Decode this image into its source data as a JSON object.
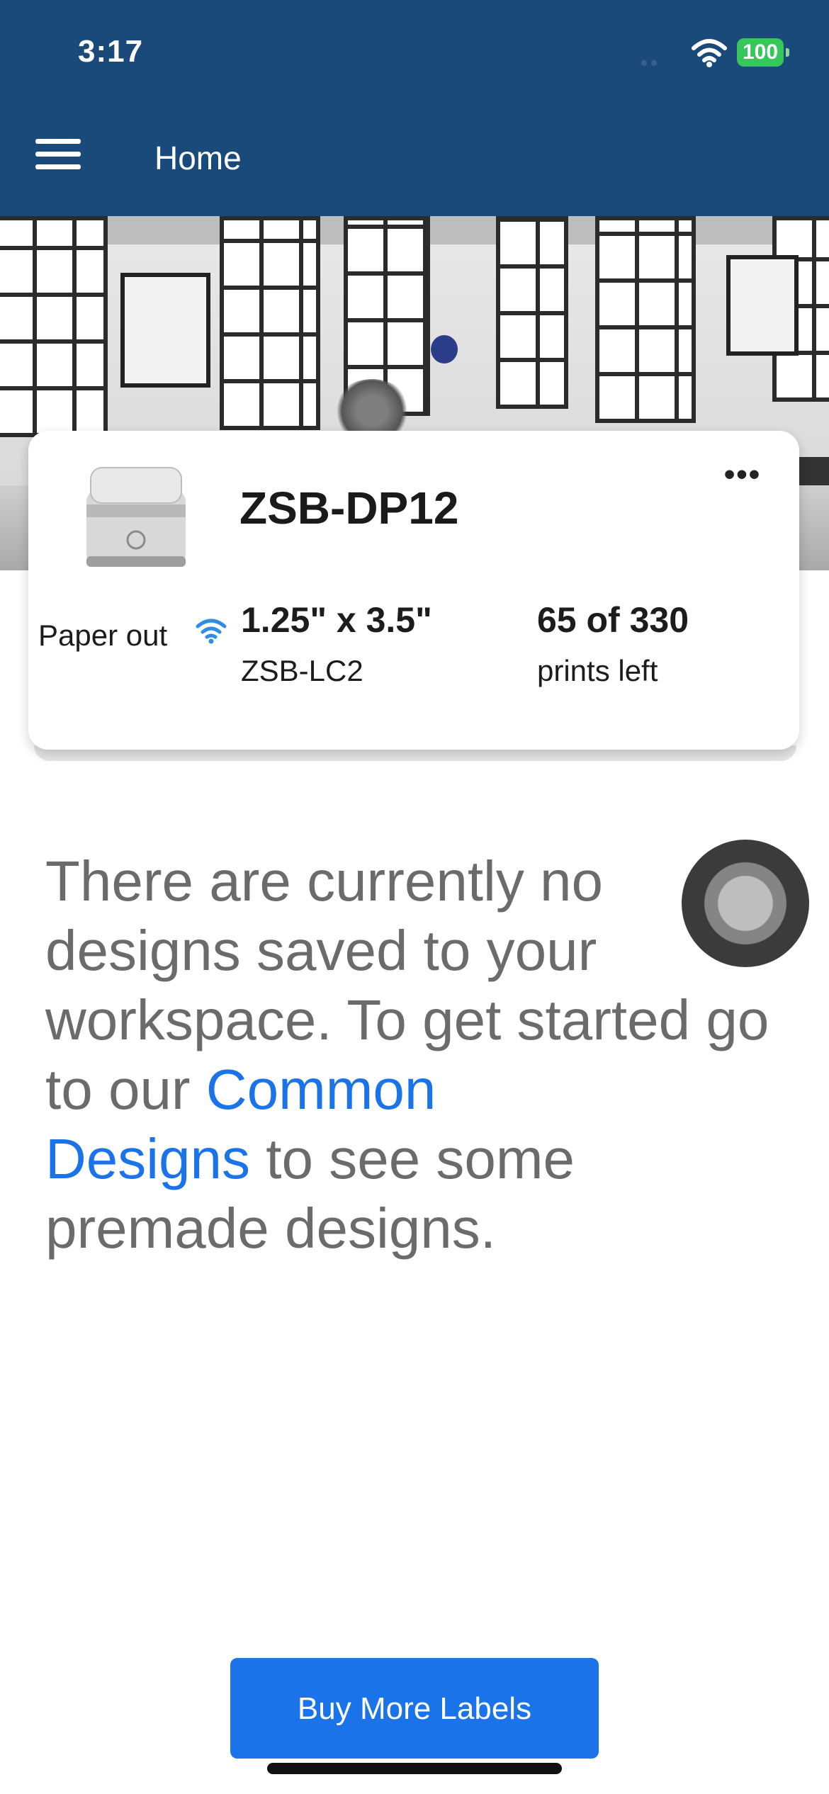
{
  "status_bar": {
    "time": "3:17",
    "battery": "100"
  },
  "header": {
    "title": "Home"
  },
  "printer": {
    "name": "ZSB-DP12",
    "status": "Paper out",
    "label_size": "1.25\" x 3.5\"",
    "label_model": "ZSB-LC2",
    "prints_count": "65 of 330",
    "prints_sub": "prints left",
    "more_label": "•••"
  },
  "message": {
    "before": "There are currently no designs saved to your workspace. To get started go to our ",
    "link_common": "Common",
    "link_designs": "Designs",
    "after": " to see some premade designs."
  },
  "buy_button": {
    "label": "Buy More Labels"
  },
  "colors": {
    "header_bg": "#1a4a7a",
    "accent": "#1a73e8",
    "battery": "#35c759"
  }
}
